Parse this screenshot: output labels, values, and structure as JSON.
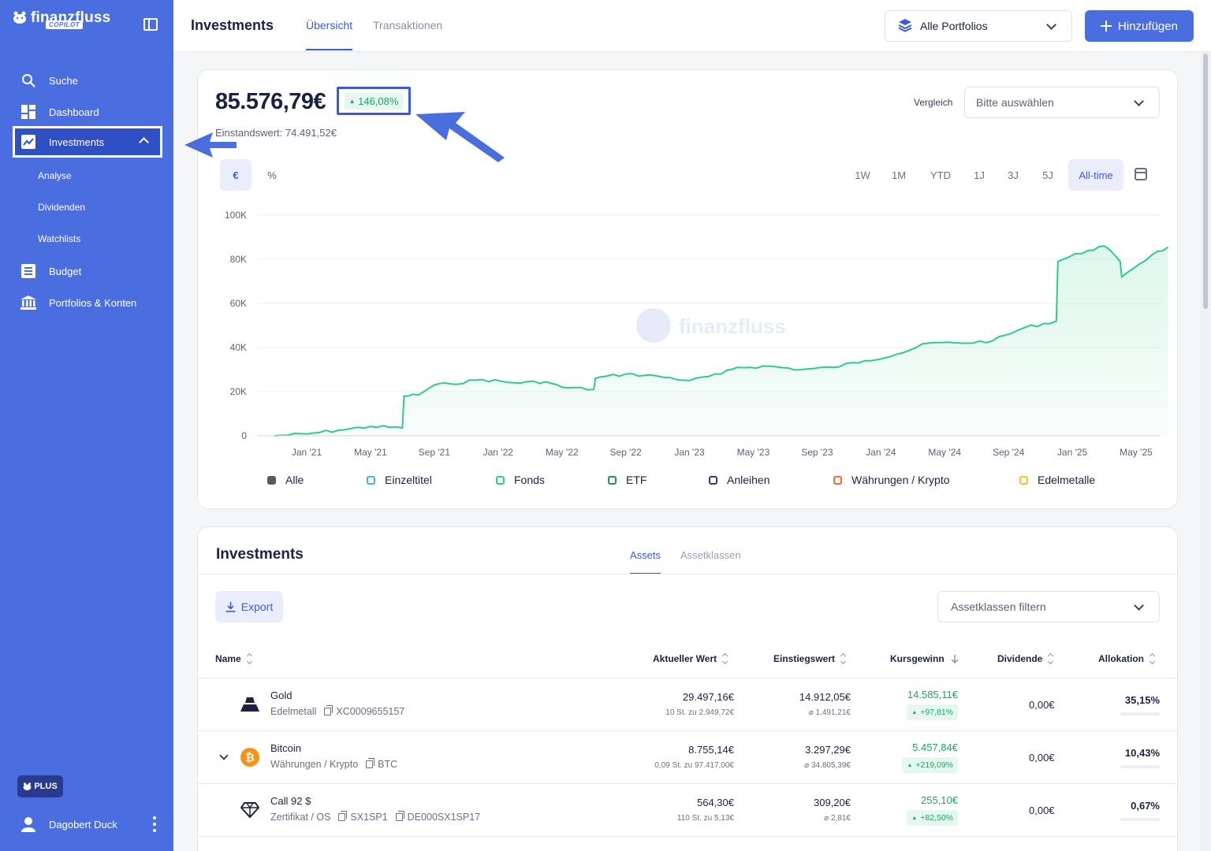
{
  "brand": {
    "name": "finanzfluss",
    "badge": "COPILOT"
  },
  "sidebar": {
    "items": [
      {
        "label": "Suche",
        "icon": "search-icon"
      },
      {
        "label": "Dashboard",
        "icon": "dashboard-icon"
      },
      {
        "label": "Investments",
        "icon": "chart-trend-icon",
        "active": true
      },
      {
        "label": "Budget",
        "icon": "list-icon"
      },
      {
        "label": "Portfolios & Konten",
        "icon": "bank-icon"
      }
    ],
    "subitems": [
      "Analyse",
      "Dividenden",
      "Watchlists"
    ],
    "plus_label": "PLUS",
    "user_name": "Dagobert Duck"
  },
  "header": {
    "title": "Investments",
    "tabs": [
      {
        "label": "Übersicht",
        "active": true
      },
      {
        "label": "Transaktionen",
        "active": false
      }
    ],
    "portfolio_select": "Alle Portfolios",
    "add_button": "Hinzufügen"
  },
  "overview": {
    "total_value": "85.576,79€",
    "performance": "146,08%",
    "cost_basis": "Einstandswert: 74.491,52€",
    "compare_label": "Vergleich",
    "compare_placeholder": "Bitte auswählen",
    "units": [
      "€",
      "%"
    ],
    "ranges": [
      "1W",
      "1M",
      "YTD",
      "1J",
      "3J",
      "5J",
      "All-time"
    ],
    "active_range": "All-time"
  },
  "chart_data": {
    "type": "area",
    "watermark": "finanzfluss",
    "yticks": [
      "100K",
      "80K",
      "60K",
      "40K",
      "20K",
      "0"
    ],
    "ylim": [
      0,
      100000
    ],
    "xticks": [
      "Jan '21",
      "May '21",
      "Sep '21",
      "Jan '22",
      "May '22",
      "Sep '22",
      "Jan '23",
      "May '23",
      "Sep '23",
      "Jan '24",
      "May '24",
      "Sep '24",
      "Jan '25",
      "May '25"
    ],
    "line_color": "#2ecc87",
    "series": [
      {
        "values": [
          {
            "x": "2020-11",
            "y": 0
          },
          {
            "x": "2021-01",
            "y": 800
          },
          {
            "x": "2021-03",
            "y": 2500
          },
          {
            "x": "2021-05",
            "y": 4200
          },
          {
            "x": "2021-07",
            "y": 3500
          },
          {
            "x": "2021-07",
            "y": 18000
          },
          {
            "x": "2021-08",
            "y": 18500
          },
          {
            "x": "2021-09",
            "y": 23000
          },
          {
            "x": "2021-10",
            "y": 23500
          },
          {
            "x": "2021-12",
            "y": 25500
          },
          {
            "x": "2022-02",
            "y": 24000
          },
          {
            "x": "2022-04",
            "y": 24500
          },
          {
            "x": "2022-05",
            "y": 22000
          },
          {
            "x": "2022-07",
            "y": 21000
          },
          {
            "x": "2022-07",
            "y": 26000
          },
          {
            "x": "2022-09",
            "y": 28000
          },
          {
            "x": "2022-11",
            "y": 27000
          },
          {
            "x": "2023-01",
            "y": 25000
          },
          {
            "x": "2023-03",
            "y": 28000
          },
          {
            "x": "2023-04",
            "y": 31000
          },
          {
            "x": "2023-06",
            "y": 31500
          },
          {
            "x": "2023-08",
            "y": 30000
          },
          {
            "x": "2023-10",
            "y": 31000
          },
          {
            "x": "2023-12",
            "y": 34000
          },
          {
            "x": "2024-02",
            "y": 37000
          },
          {
            "x": "2024-04",
            "y": 42000
          },
          {
            "x": "2024-06",
            "y": 42000
          },
          {
            "x": "2024-08",
            "y": 43000
          },
          {
            "x": "2024-10",
            "y": 49000
          },
          {
            "x": "2024-12",
            "y": 52000
          },
          {
            "x": "2024-12",
            "y": 79000
          },
          {
            "x": "2025-02",
            "y": 84000
          },
          {
            "x": "2025-03",
            "y": 86000
          },
          {
            "x": "2025-04",
            "y": 79000
          },
          {
            "x": "2025-04",
            "y": 72000
          },
          {
            "x": "2025-06",
            "y": 82000
          },
          {
            "x": "2025-07",
            "y": 85500
          }
        ]
      }
    ],
    "legend": [
      {
        "name": "Alle",
        "color": "#555a66",
        "filled": true
      },
      {
        "name": "Einzeltitel",
        "color": "#3cb7e8"
      },
      {
        "name": "Fonds",
        "color": "#2ecc87"
      },
      {
        "name": "ETF",
        "color": "#1f8f5e"
      },
      {
        "name": "Anleihen",
        "color": "#2a3b8f"
      },
      {
        "name": "Währungen / Krypto",
        "color": "#f0653a"
      },
      {
        "name": "Edelmetalle",
        "color": "#f2c230"
      }
    ]
  },
  "investments": {
    "title": "Investments",
    "tabs": [
      {
        "label": "Assets",
        "active": true
      },
      {
        "label": "Assetklassen",
        "active": false
      }
    ],
    "export_label": "Export",
    "filter_placeholder": "Assetklassen filtern",
    "columns": [
      "Name",
      "Aktueller Wert",
      "Einstiegswert",
      "Kursgewinn",
      "Dividende",
      "Allokation"
    ],
    "rows": [
      {
        "name": "Gold",
        "class": "Edelmetall",
        "ids": [
          "XC0009655157"
        ],
        "icon": "gold-bar-icon",
        "value": "29.497,16€",
        "value_sub": "10 St. zu 2.949,72€",
        "entry": "14.912,05€",
        "entry_sub": "⌀ 1.491,21€",
        "gain": "14.585,11€",
        "gain_pct": "+97,81%",
        "dividend": "0,00€",
        "allocation": "35,15%",
        "allocation_share": 0.3515,
        "expandable": false
      },
      {
        "name": "Bitcoin",
        "class": "Währungen / Krypto",
        "ids": [
          "BTC"
        ],
        "icon": "bitcoin-icon",
        "value": "8.755,14€",
        "value_sub": "0,09 St. zu 97.417,00€",
        "entry": "3.297,29€",
        "entry_sub": "⌀ 34.805,39€",
        "gain": "5.457,84€",
        "gain_pct": "+219,09%",
        "dividend": "0,00€",
        "allocation": "10,43%",
        "allocation_share": 0.1043,
        "expandable": true
      },
      {
        "name": "Call 92 $",
        "class": "Zertifikat / OS",
        "ids": [
          "SX1SP1",
          "DE000SX1SP17"
        ],
        "icon": "diamond-icon",
        "value": "564,30€",
        "value_sub": "110 St. zu 5,13€",
        "entry": "309,20€",
        "entry_sub": "⌀ 2,81€",
        "gain": "255,10€",
        "gain_pct": "+82,50%",
        "dividend": "0,00€",
        "allocation": "0,67%",
        "allocation_share": 0.0067,
        "expandable": false
      }
    ]
  }
}
